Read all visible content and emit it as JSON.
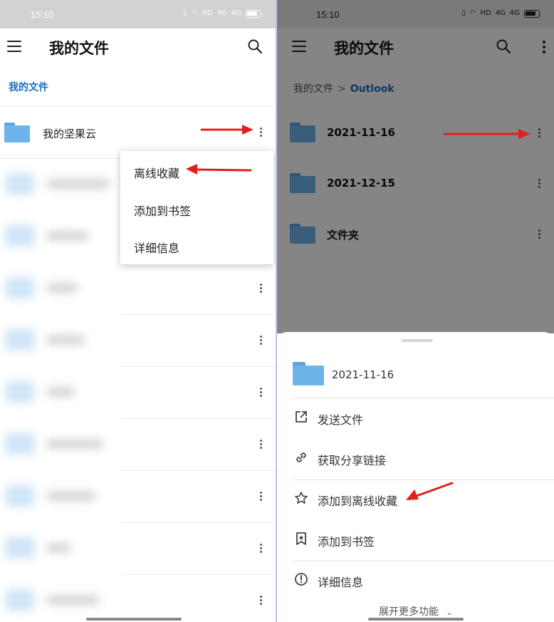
{
  "status_bar": {
    "time": "15:10",
    "net_label": "HD",
    "sig1": "4G",
    "sig2": "4G"
  },
  "left": {
    "title": "我的文件",
    "breadcrumb": "我的文件",
    "first_folder": "我的坚果云",
    "menu": [
      "离线收藏",
      "添加到书签",
      "详细信息"
    ]
  },
  "right": {
    "title": "我的文件",
    "breadcrumb_root": "我的文件",
    "breadcrumb_sep": ">",
    "breadcrumb_current": "Outlook",
    "folders": [
      "2021-11-16",
      "2021-12-15",
      "文件夹"
    ],
    "sheet": {
      "folder_name": "2021-11-16",
      "actions": [
        "发送文件",
        "获取分享链接",
        "添加到离线收藏",
        "添加到书签",
        "详细信息"
      ],
      "expand_label": "展开更多功能"
    }
  },
  "colors": {
    "accent": "#1a6fbf",
    "folder": "#6db4ea",
    "arrow": "#e02020"
  }
}
